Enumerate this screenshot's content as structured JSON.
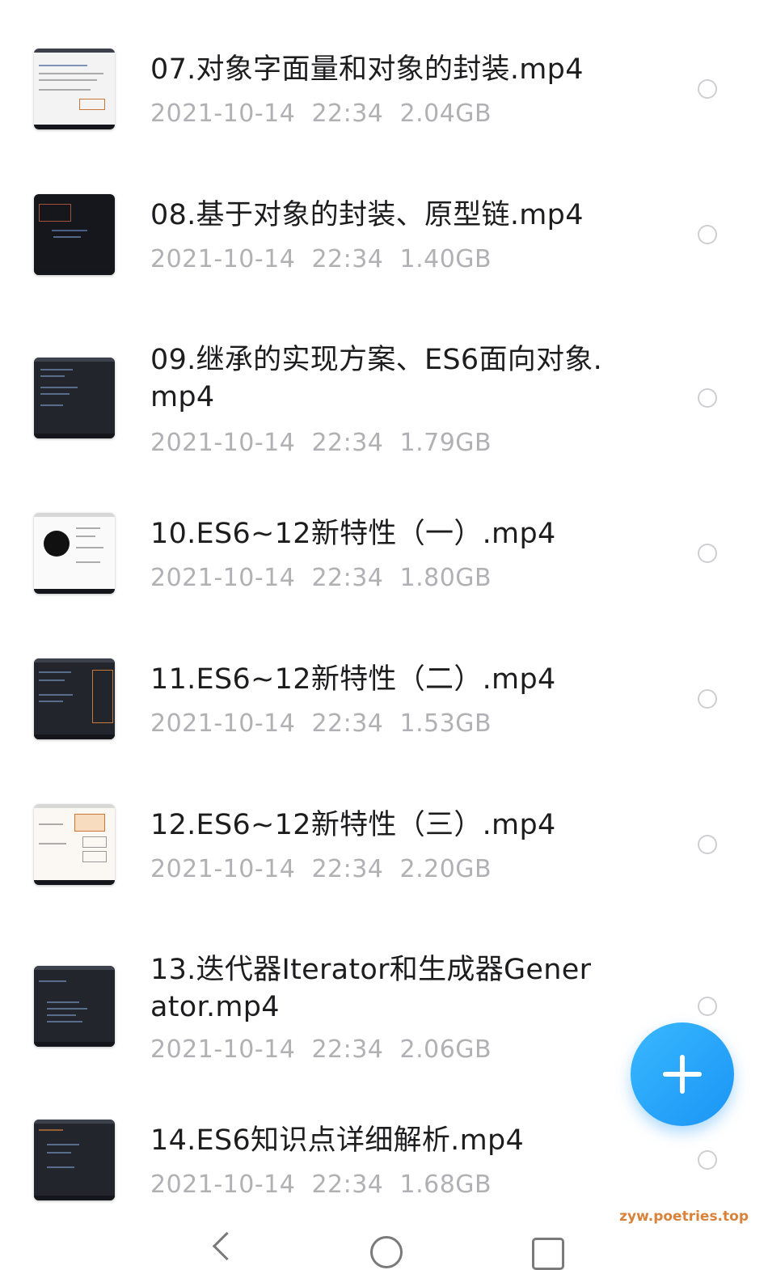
{
  "files": [
    {
      "title": "07.对象字面量和对象的封装.mp4",
      "date": "2021-10-14",
      "time": "22:34",
      "size": "2.04GB",
      "thumb_icon": "video-thumbnail-icon"
    },
    {
      "title": "08.基于对象的封装、原型链.mp4",
      "date": "2021-10-14",
      "time": "22:34",
      "size": "1.40GB",
      "thumb_icon": "video-thumbnail-icon"
    },
    {
      "title": "09.继承的实现方案、ES6面向对象.mp4",
      "date": "2021-10-14",
      "time": "22:34",
      "size": "1.79GB",
      "thumb_icon": "video-thumbnail-icon"
    },
    {
      "title": "10.ES6~12新特性（一）.mp4",
      "date": "2021-10-14",
      "time": "22:34",
      "size": "1.80GB",
      "thumb_icon": "video-thumbnail-icon"
    },
    {
      "title": "11.ES6~12新特性（二）.mp4",
      "date": "2021-10-14",
      "time": "22:34",
      "size": "1.53GB",
      "thumb_icon": "video-thumbnail-icon"
    },
    {
      "title": "12.ES6~12新特性（三）.mp4",
      "date": "2021-10-14",
      "time": "22:34",
      "size": "2.20GB",
      "thumb_icon": "video-thumbnail-icon"
    },
    {
      "title": "13.迭代器Iterator和生成器Generator.mp4",
      "date": "2021-10-14",
      "time": "22:34",
      "size": "2.06GB",
      "thumb_icon": "video-thumbnail-icon"
    },
    {
      "title": "14.ES6知识点详细解析.mp4",
      "date": "2021-10-14",
      "time": "22:34",
      "size": "1.68GB",
      "thumb_icon": "video-thumbnail-icon"
    }
  ],
  "fab": {
    "icon": "plus-icon",
    "color": "#1a95f5"
  },
  "watermark": "zyw.poetries.top",
  "navbar": {
    "icons": [
      "back-icon",
      "home-icon",
      "recent-apps-icon"
    ]
  }
}
